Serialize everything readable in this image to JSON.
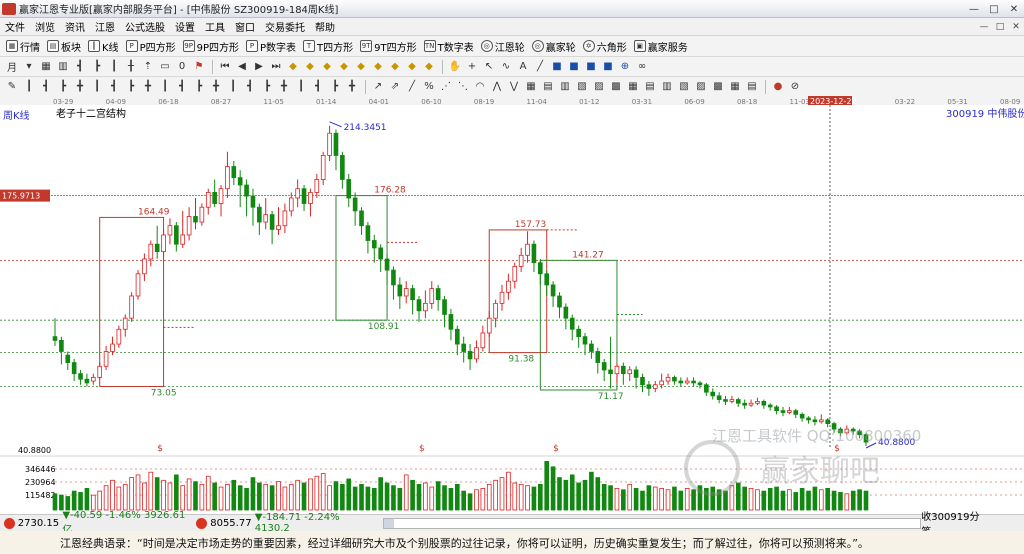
{
  "window": {
    "title": "赢家江恩专业版[赢家内部服务平台] - [中伟股份  SZ300919-184周K线]",
    "controls": [
      "—",
      "□",
      "✕"
    ]
  },
  "menu": {
    "items": [
      "文件",
      "浏览",
      "资讯",
      "江恩",
      "公式选股",
      "设置",
      "工具",
      "窗口",
      "交易委托",
      "帮助"
    ],
    "mdi": [
      "—",
      "□",
      "✕"
    ]
  },
  "nav": {
    "items": [
      {
        "label": "行情",
        "icon": "grid-icon",
        "glyph": "▦"
      },
      {
        "label": "板块",
        "icon": "sector-icon",
        "glyph": "▤"
      },
      {
        "label": "K线",
        "icon": "kline-icon",
        "glyph": "┃"
      },
      {
        "label": "P四方形",
        "icon": "p-square-icon",
        "glyph": "P"
      },
      {
        "label": "9P四方形",
        "icon": "9p-square-icon",
        "glyph": "9P"
      },
      {
        "label": "P数字表",
        "icon": "p-table-icon",
        "glyph": "P"
      },
      {
        "label": "T四方形",
        "icon": "t-square-icon",
        "glyph": "T"
      },
      {
        "label": "9T四方形",
        "icon": "9t-square-icon",
        "glyph": "9T"
      },
      {
        "label": "T数字表",
        "icon": "t-table-icon",
        "glyph": "TN"
      },
      {
        "label": "江恩轮",
        "icon": "gann-wheel-icon",
        "glyph": "◎"
      },
      {
        "label": "赢家轮",
        "icon": "winner-wheel-icon",
        "glyph": "◎"
      },
      {
        "label": "六角形",
        "icon": "hexagon-icon",
        "glyph": "✡"
      },
      {
        "label": "赢家服务",
        "icon": "service-icon",
        "glyph": "▣"
      }
    ]
  },
  "toolbar1": {
    "period": "月"
  },
  "chart": {
    "period_label": "周K线",
    "structure_label": "老子十二宫结构",
    "stock_label": "300919  中伟股份",
    "price_axis_marker": "175.9713",
    "low_axis_label": "40.8800",
    "volume_axis": [
      "346446",
      "230964",
      "115482"
    ],
    "date_labels": [
      "03-29",
      "04-09",
      "06-18",
      "08-27",
      "11-05",
      "01-14",
      "04-01",
      "06-10",
      "08-19",
      "11-04",
      "01-12",
      "03-31",
      "06-09",
      "08-18",
      "11-03",
      "2023-12-22",
      "03-22",
      "05-31",
      "08-09"
    ],
    "annotations": [
      "214.3451",
      "176.28",
      "164.49",
      "157.73",
      "141.27",
      "108.91",
      "91.38",
      "73.05",
      "71.17",
      "40.8800"
    ],
    "dollar_mark": "$",
    "watermark_text": "江恩工具软件 QQ:100800360",
    "watermark_logo": "赢家聊吧"
  },
  "chart_data": {
    "type": "candlestick",
    "title": "中伟股份 300919 周K线",
    "ylim": [
      40.88,
      230
    ],
    "candles_ohlc": [
      [
        100,
        98,
        110,
        95
      ],
      [
        98,
        92,
        100,
        85
      ],
      [
        90,
        86,
        92,
        82
      ],
      [
        86,
        80,
        88,
        76
      ],
      [
        80,
        77,
        82,
        74
      ],
      [
        77,
        75,
        80,
        73
      ],
      [
        76,
        78,
        80,
        74
      ],
      [
        78,
        84,
        86,
        77
      ],
      [
        84,
        92,
        95,
        82
      ],
      [
        92,
        96,
        100,
        90
      ],
      [
        96,
        104,
        106,
        94
      ],
      [
        104,
        110,
        112,
        100
      ],
      [
        110,
        122,
        124,
        108
      ],
      [
        122,
        134,
        136,
        120
      ],
      [
        134,
        142,
        145,
        130
      ],
      [
        142,
        150,
        152,
        138
      ],
      [
        150,
        146,
        160,
        142
      ],
      [
        146,
        155,
        158,
        143
      ],
      [
        155,
        160,
        164,
        150
      ],
      [
        160,
        150,
        162,
        146
      ],
      [
        150,
        155,
        168,
        148
      ],
      [
        155,
        165,
        170,
        152
      ],
      [
        165,
        162,
        175,
        158
      ],
      [
        162,
        170,
        172,
        160
      ],
      [
        170,
        178,
        180,
        166
      ],
      [
        178,
        172,
        185,
        170
      ],
      [
        172,
        180,
        182,
        165
      ],
      [
        180,
        192,
        200,
        175
      ],
      [
        192,
        186,
        195,
        182
      ],
      [
        186,
        182,
        190,
        170
      ],
      [
        182,
        176,
        185,
        165
      ],
      [
        176,
        170,
        180,
        160
      ],
      [
        170,
        162,
        172,
        155
      ],
      [
        162,
        166,
        175,
        158
      ],
      [
        166,
        158,
        168,
        150
      ],
      [
        158,
        160,
        170,
        155
      ],
      [
        160,
        168,
        172,
        156
      ],
      [
        168,
        175,
        178,
        165
      ],
      [
        175,
        180,
        185,
        170
      ],
      [
        180,
        172,
        182,
        168
      ],
      [
        172,
        178,
        180,
        165
      ],
      [
        178,
        185,
        188,
        175
      ],
      [
        185,
        198,
        200,
        182
      ],
      [
        198,
        210,
        214,
        195
      ],
      [
        210,
        198,
        212,
        190
      ],
      [
        198,
        185,
        200,
        180
      ],
      [
        185,
        175,
        188,
        170
      ],
      [
        175,
        168,
        178,
        160
      ],
      [
        168,
        160,
        170,
        155
      ],
      [
        160,
        152,
        162,
        145
      ],
      [
        152,
        148,
        155,
        140
      ],
      [
        148,
        142,
        150,
        135
      ],
      [
        142,
        136,
        145,
        128
      ],
      [
        136,
        128,
        138,
        120
      ],
      [
        128,
        122,
        132,
        115
      ],
      [
        122,
        126,
        130,
        118
      ],
      [
        126,
        120,
        128,
        112
      ],
      [
        120,
        114,
        122,
        108
      ],
      [
        114,
        118,
        125,
        110
      ],
      [
        118,
        126,
        130,
        115
      ],
      [
        126,
        120,
        128,
        114
      ],
      [
        120,
        112,
        122,
        105
      ],
      [
        112,
        104,
        115,
        98
      ],
      [
        104,
        96,
        106,
        90
      ],
      [
        96,
        92,
        100,
        86
      ],
      [
        92,
        88,
        96,
        82
      ],
      [
        88,
        94,
        98,
        86
      ],
      [
        94,
        102,
        106,
        92
      ],
      [
        102,
        110,
        114,
        100
      ],
      [
        110,
        118,
        120,
        105
      ],
      [
        118,
        124,
        128,
        114
      ],
      [
        124,
        130,
        134,
        120
      ],
      [
        130,
        138,
        140,
        126
      ],
      [
        138,
        144,
        148,
        135
      ],
      [
        144,
        150,
        157,
        140
      ],
      [
        150,
        140,
        152,
        135
      ],
      [
        140,
        134,
        142,
        128
      ],
      [
        134,
        128,
        136,
        122
      ],
      [
        128,
        122,
        130,
        116
      ],
      [
        122,
        116,
        124,
        110
      ],
      [
        116,
        110,
        118,
        104
      ],
      [
        110,
        104,
        112,
        98
      ],
      [
        104,
        100,
        106,
        94
      ],
      [
        100,
        96,
        102,
        90
      ],
      [
        96,
        92,
        98,
        88
      ],
      [
        92,
        86,
        94,
        80
      ],
      [
        86,
        82,
        88,
        76
      ],
      [
        82,
        80,
        100,
        72
      ],
      [
        80,
        84,
        86,
        75
      ],
      [
        84,
        80,
        86,
        74
      ],
      [
        80,
        82,
        84,
        76
      ],
      [
        82,
        78,
        84,
        72
      ],
      [
        78,
        74,
        80,
        70
      ],
      [
        74,
        72,
        76,
        68
      ],
      [
        72,
        74,
        76,
        70
      ],
      [
        74,
        76,
        80,
        72
      ],
      [
        76,
        78,
        80,
        74
      ],
      [
        78,
        76,
        79,
        74
      ],
      [
        76,
        75,
        78,
        73
      ],
      [
        75,
        76,
        78,
        74
      ],
      [
        76,
        75,
        78,
        73
      ],
      [
        75,
        74,
        76,
        72
      ],
      [
        74,
        70,
        75,
        68
      ],
      [
        70,
        68,
        72,
        66
      ],
      [
        68,
        66,
        70,
        64
      ],
      [
        66,
        65,
        68,
        63
      ],
      [
        65,
        66,
        68,
        64
      ],
      [
        66,
        64,
        67,
        62
      ],
      [
        64,
        63,
        66,
        61
      ],
      [
        63,
        64,
        66,
        62
      ],
      [
        64,
        65,
        67,
        63
      ],
      [
        65,
        63,
        66,
        61
      ],
      [
        63,
        62,
        64,
        60
      ],
      [
        62,
        60,
        63,
        58
      ],
      [
        60,
        59,
        62,
        57
      ],
      [
        59,
        60,
        62,
        58
      ],
      [
        60,
        58,
        61,
        56
      ],
      [
        58,
        56,
        59,
        54
      ],
      [
        56,
        55,
        57,
        53
      ],
      [
        55,
        54,
        57,
        52
      ],
      [
        54,
        55,
        58,
        53
      ],
      [
        55,
        53,
        56,
        51
      ],
      [
        53,
        50,
        54,
        48
      ],
      [
        50,
        48,
        51,
        46
      ],
      [
        48,
        50,
        52,
        47
      ],
      [
        50,
        49,
        51,
        47
      ],
      [
        49,
        47,
        50,
        45
      ],
      [
        47,
        43,
        48,
        40.88
      ]
    ],
    "volumes": [
      60,
      55,
      50,
      70,
      65,
      80,
      55,
      70,
      90,
      110,
      85,
      95,
      120,
      130,
      100,
      140,
      120,
      110,
      100,
      130,
      90,
      115,
      105,
      95,
      125,
      100,
      85,
      95,
      110,
      90,
      80,
      120,
      100,
      95,
      90,
      105,
      85,
      95,
      110,
      100,
      115,
      125,
      135,
      90,
      105,
      95,
      115,
      85,
      95,
      85,
      80,
      120,
      100,
      90,
      80,
      130,
      110,
      95,
      100,
      85,
      105,
      90,
      80,
      95,
      70,
      60,
      75,
      80,
      95,
      110,
      120,
      140,
      100,
      95,
      90,
      85,
      95,
      180,
      160,
      120,
      110,
      130,
      100,
      110,
      140,
      120,
      95,
      90,
      80,
      75,
      95,
      80,
      70,
      90,
      85,
      80,
      75,
      85,
      70,
      80,
      75,
      90,
      80,
      85,
      75,
      70,
      90,
      100,
      85,
      80,
      75,
      70,
      80,
      85,
      70,
      75,
      65,
      80,
      70,
      85,
      75,
      80,
      70,
      65,
      60,
      70,
      75,
      70
    ]
  },
  "status": {
    "index1": "2730.15",
    "index1_chg": "▼-40.59 -1.46% 3926.61亿",
    "index2": "8055.77",
    "index2_chg": "▼-184.71 -2.24% 4130.2",
    "right": "收300919分笔"
  },
  "quote": {
    "text": "江恩经典语录：“时间是决定市场走势的重要因素，经过详细研究大市及个别股票的过往记录，你将可以证明，历史确实重复发生；而了解过往，你将可以预测将来。”。"
  }
}
